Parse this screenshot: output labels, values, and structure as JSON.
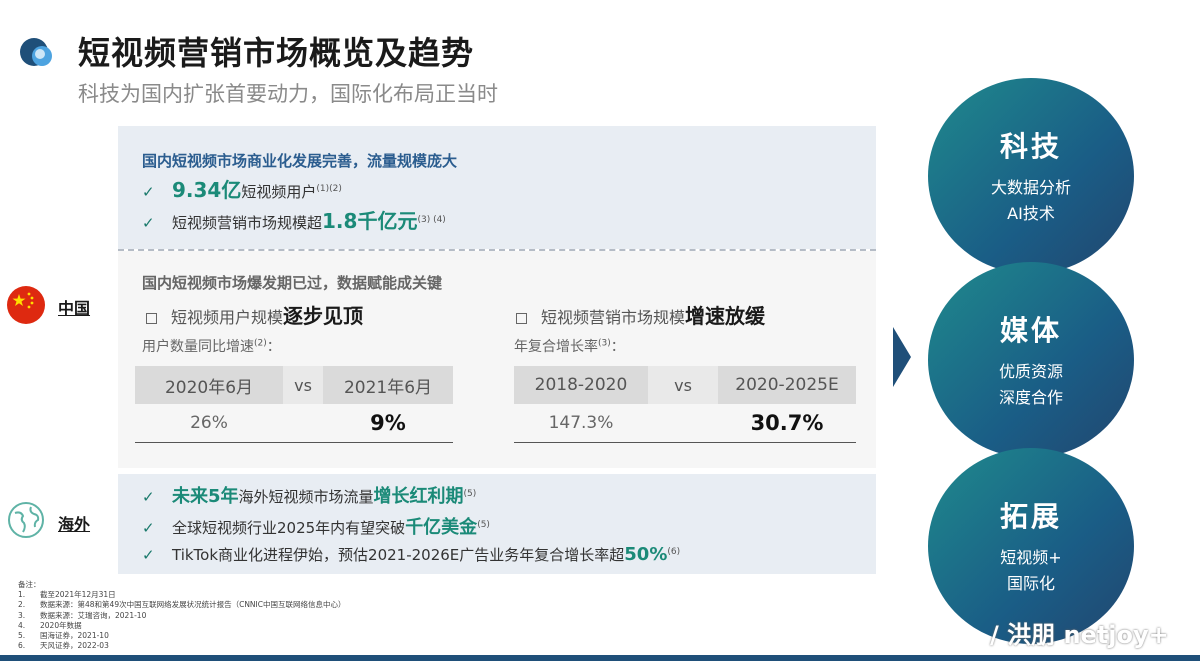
{
  "header": {
    "title": "短视频营销市场概览及趋势",
    "subtitle": "科技为国内扩张首要动力，国际化布局正当时"
  },
  "regions": {
    "china": "中国",
    "overseas": "海外"
  },
  "china_top": {
    "heading": "国内短视频市场商业化发展完善，流量规模庞大",
    "line1": {
      "value": "9.34亿",
      "text": "短视频用户",
      "ref": "(1)(2)"
    },
    "line2": {
      "text": "短视频营销市场规模超",
      "value": "1.8千亿元",
      "ref": "(3) (4)"
    }
  },
  "china_mid": {
    "heading": "国内短视频市场爆发期已过，数据赋能成关键",
    "left": {
      "title_normal": "短视频用户规模",
      "title_bold": "逐步见顶",
      "label": "用户数量同比增速",
      "label_ref": "(2)",
      "label_suffix": "：",
      "col1": "2020年6月",
      "vs": "vs",
      "col2": "2021年6月",
      "val1": "26%",
      "val2": "9%"
    },
    "right": {
      "title_normal": "短视频营销市场规模",
      "title_bold": "增速放缓",
      "label": "年复合增长率",
      "label_ref": "(3)",
      "label_suffix": "：",
      "col1": "2018-2020",
      "vs": "vs",
      "col2": "2020-2025E",
      "val1": "147.3%",
      "val2": "30.7%"
    }
  },
  "overseas": {
    "line1": {
      "highlight1": "未来5年",
      "text": "海外短视频市场流量",
      "highlight2": "增长红利期",
      "ref": "(5)"
    },
    "line2": {
      "text": "全球短视频行业2025年内有望突破",
      "highlight": "千亿美金",
      "ref": "(5)"
    },
    "line3": {
      "text": "TikTok商业化进程伊始，预估2021-2026E广告业务年复合增长率超",
      "highlight": "50%",
      "ref": "(6)"
    }
  },
  "check_mark": "✓",
  "pillars": [
    {
      "title": "科技",
      "lines": [
        "大数据分析",
        "AI技术"
      ]
    },
    {
      "title": "媒体",
      "lines": [
        "优质资源",
        "深度合作"
      ]
    },
    {
      "title": "拓展",
      "lines": [
        "短视频+",
        "国际化"
      ]
    }
  ],
  "notes": {
    "heading": "备注：",
    "items": [
      {
        "n": "1.",
        "text": "截至2021年12月31日"
      },
      {
        "n": "2.",
        "text": "数据来源：第48和第49次中国互联网络发展状况统计报告（CNNIC中国互联网络信息中心）"
      },
      {
        "n": "3.",
        "text": "数据来源：艾瑞咨询，2021-10"
      },
      {
        "n": "4.",
        "text": "2020年数据"
      },
      {
        "n": "5.",
        "text": "国海证券，2021-10"
      },
      {
        "n": "6.",
        "text": "天风证券，2022-03"
      }
    ]
  },
  "watermark": "/ 洪朋 netjoy+",
  "colors": {
    "accent_teal": "#1b8a78",
    "heading_blue": "#2b5d8f",
    "circle_dark": "#1f4f79"
  }
}
